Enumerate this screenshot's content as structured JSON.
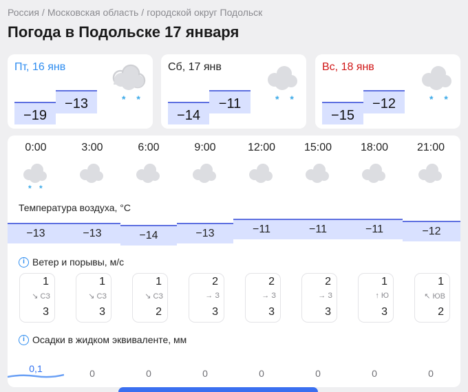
{
  "breadcrumb": {
    "items": [
      "Россия",
      "Московская область",
      "городской округ Подольск"
    ],
    "separator": "/"
  },
  "title": "Погода в Подольске 17 января",
  "colors": {
    "accent_blue": "#2d8cf0",
    "weekend_red": "#d01616",
    "temp_fill": "#d9e1ff",
    "temp_line": "#5d6fe0",
    "snow": "#3aa9e8"
  },
  "days": [
    {
      "label": "Пт, 16 янв",
      "min": "−19",
      "max": "−13",
      "icon": "cloudy-snow-icon",
      "color": "#2d8cf0"
    },
    {
      "label": "Сб, 17 янв",
      "min": "−14",
      "max": "−11",
      "icon": "cloudy-snow-icon",
      "color": "#1f1f1f"
    },
    {
      "label": "Вс, 18 янв",
      "min": "−15",
      "max": "−12",
      "icon": "cloudy-snow-icon",
      "color": "#d01616"
    }
  ],
  "snow_glyph": "* *",
  "hourly": {
    "times": [
      "0:00",
      "3:00",
      "6:00",
      "9:00",
      "12:00",
      "15:00",
      "18:00",
      "21:00"
    ],
    "icons": [
      "cloudy-snow-icon",
      "cloudy-icon",
      "cloudy-icon",
      "cloudy-icon",
      "cloudy-icon",
      "cloudy-icon",
      "cloudy-icon",
      "cloudy-icon"
    ],
    "temperature_label": "Температура воздуха, °C",
    "temperatures": [
      "−13",
      "−13",
      "−14",
      "−13",
      "−11",
      "−11",
      "−11",
      "−12"
    ],
    "wind_label": "Ветер и порывы, м/с",
    "wind": [
      {
        "speed": "1",
        "dir": "↘ СЗ",
        "gust": "3"
      },
      {
        "speed": "1",
        "dir": "↘ СЗ",
        "gust": "3"
      },
      {
        "speed": "1",
        "dir": "↘ СЗ",
        "gust": "2"
      },
      {
        "speed": "2",
        "dir": "→ З",
        "gust": "3"
      },
      {
        "speed": "2",
        "dir": "→ З",
        "gust": "3"
      },
      {
        "speed": "2",
        "dir": "→ З",
        "gust": "3"
      },
      {
        "speed": "1",
        "dir": "↑ Ю",
        "gust": "3"
      },
      {
        "speed": "1",
        "dir": "↖ ЮВ",
        "gust": "2"
      }
    ],
    "precip_label": "Осадки в жидком эквиваленте, мм",
    "precip": [
      "0,1",
      "0",
      "0",
      "0",
      "0",
      "0",
      "0",
      "0"
    ]
  },
  "info_glyph": "i"
}
